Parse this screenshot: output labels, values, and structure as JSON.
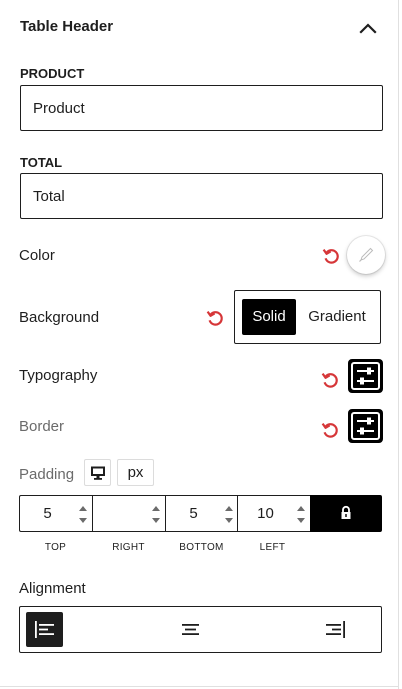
{
  "panel": {
    "title": "Table Header",
    "expanded": true,
    "toggle_icon": "chevron-up-icon"
  },
  "product_field": {
    "label": "PRODUCT",
    "value": "Product"
  },
  "total_field": {
    "label": "TOTAL",
    "value": "Total"
  },
  "color": {
    "label": "Color",
    "reset_icon": "reset-icon",
    "picker_icon": "eyedropper-icon",
    "swatch_color": "#ffffff"
  },
  "background": {
    "label": "Background",
    "reset_icon": "reset-icon",
    "options": [
      "Solid",
      "Gradient"
    ],
    "selected": "Solid"
  },
  "typography": {
    "label": "Typography",
    "reset_icon": "reset-icon",
    "button_icon": "sliders-icon"
  },
  "border": {
    "label": "Border",
    "reset_icon": "reset-icon",
    "button_icon": "sliders-icon"
  },
  "padding": {
    "label": "Padding",
    "device_icon": "desktop-icon",
    "unit": "px",
    "sides": [
      {
        "label": "TOP",
        "value": "5"
      },
      {
        "label": "RIGHT",
        "value": ""
      },
      {
        "label": "BOTTOM",
        "value": "5"
      },
      {
        "label": "LEFT",
        "value": "10"
      }
    ],
    "lock_icon": "lock-icon",
    "linked": true
  },
  "alignment": {
    "label": "Alignment",
    "options": [
      "align-left-icon",
      "align-center-icon",
      "align-right-icon"
    ],
    "selected": "align-left-icon"
  },
  "colors": {
    "text": "#1e1e1e",
    "accent": "#000000",
    "reset": "#d63638",
    "border": "#1e1e1e"
  }
}
